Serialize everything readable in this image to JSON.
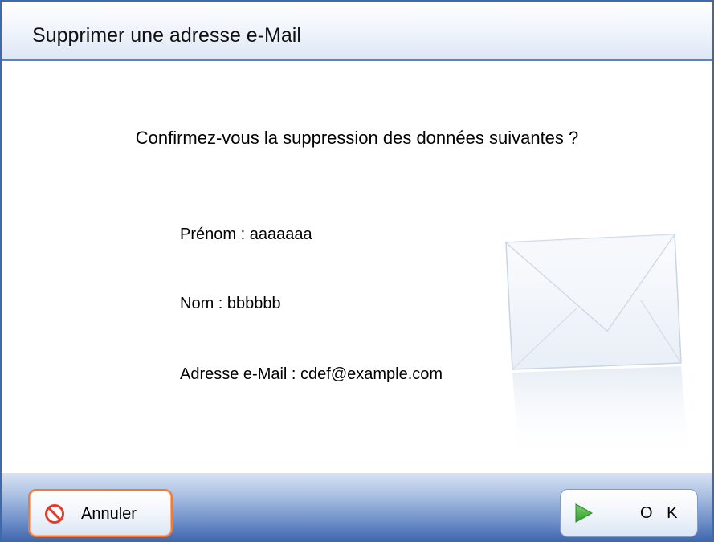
{
  "dialog": {
    "title": "Supprimer une adresse e-Mail",
    "question": "Confirmez-vous la suppression des données suivantes ?"
  },
  "fields": {
    "first_name": "Prénom : aaaaaaa",
    "last_name": "Nom : bbbbbb",
    "email": "Adresse e-Mail : cdef@example.com"
  },
  "buttons": {
    "cancel_label": "Annuler",
    "ok_label": "O K"
  },
  "icons": {
    "cancel": "prohibited-icon",
    "ok": "play-arrow-icon",
    "decoration": "envelope-icon"
  },
  "colors": {
    "frame": "#3e6aa8",
    "cancel_focus_border": "#f07a3a",
    "cancel_icon": "#e53b2f",
    "ok_icon": "#3aa935"
  }
}
